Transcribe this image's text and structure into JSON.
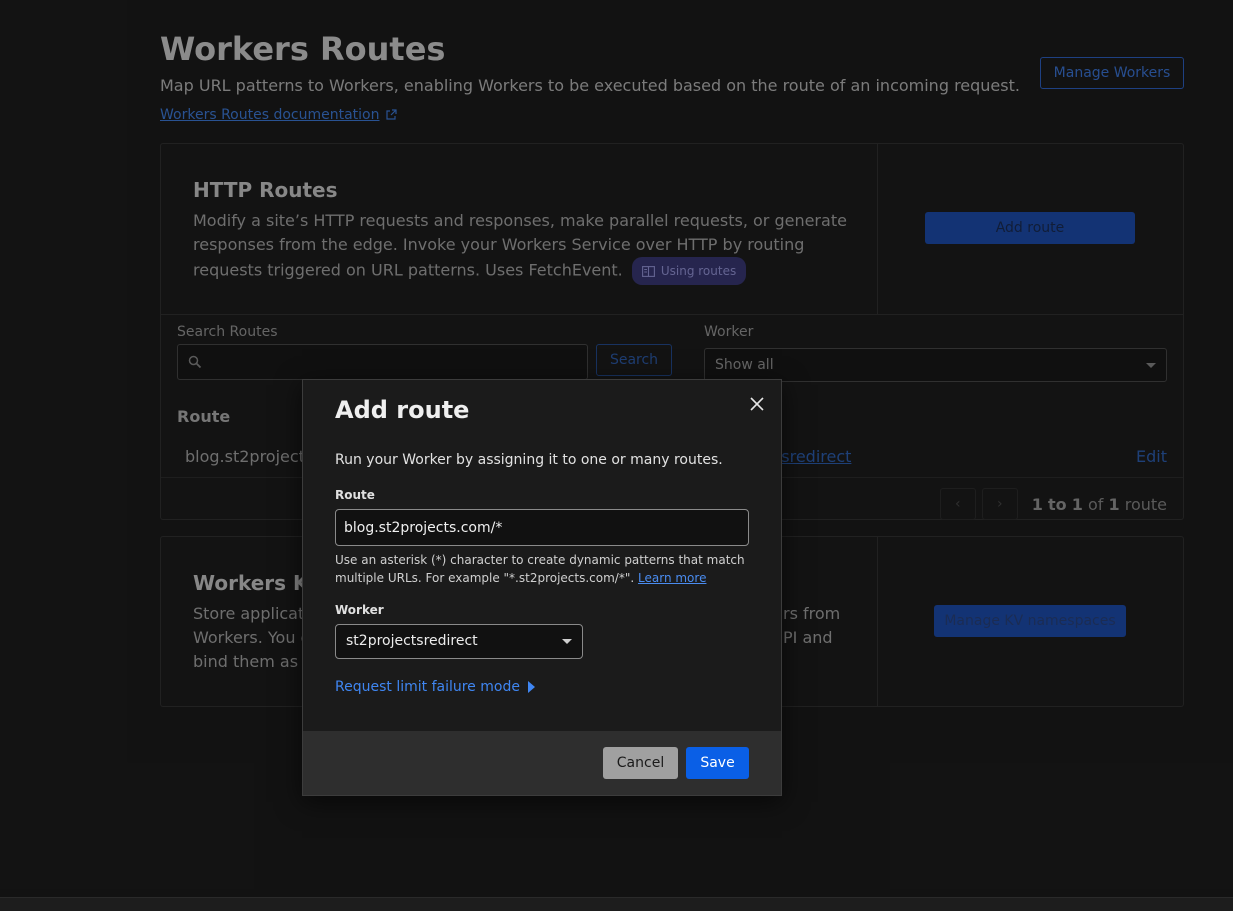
{
  "page": {
    "title": "Workers Routes",
    "subtitle": "Map URL patterns to Workers, enabling Workers to be executed based on the route of an incoming request.",
    "doc_link": "Workers Routes documentation",
    "manage_button": "Manage Workers"
  },
  "http_card": {
    "title": "HTTP Routes",
    "description": "Modify a site’s HTTP requests and responses, make parallel requests, or generate responses from the edge. Invoke your Workers Service over HTTP by routing requests triggered on URL patterns. Uses FetchEvent.",
    "badge": "Using routes",
    "add_route_button": "Add route",
    "search_label": "Search Routes",
    "search_placeholder": "",
    "search_button": "Search",
    "worker_label": "Worker",
    "worker_filter_value": "Show all",
    "table": {
      "column_route": "Route",
      "rows": [
        {
          "route": "blog.st2projects",
          "worker": "tsredirect",
          "action": "Edit"
        }
      ]
    },
    "pagination": {
      "range_start": "1",
      "range_sep": "to",
      "range_end": "1",
      "of": "of",
      "total": "1",
      "unit": "route"
    }
  },
  "kv_card": {
    "title": "Workers KV",
    "description_left": "Store applicatio\nWorkers. You c\nbind them as n",
    "description_right": "rs from\nPI and",
    "button": "Manage KV namespaces"
  },
  "modal": {
    "title": "Add route",
    "intro": "Run your Worker by assigning it to one or many routes.",
    "route_label": "Route",
    "route_value": "blog.st2projects.com/*",
    "help_text": "Use an asterisk (*) character to create dynamic patterns that match multiple URLs. For example \"*.st2projects.com/*\".",
    "help_link": "Learn more",
    "worker_label": "Worker",
    "worker_value": "st2projectsredirect",
    "limit_link": "Request limit failure mode",
    "cancel_button": "Cancel",
    "save_button": "Save"
  },
  "colors": {
    "accent": "#0a5fe6",
    "link": "#3f86f2",
    "badge_bg": "#3b3a78"
  }
}
